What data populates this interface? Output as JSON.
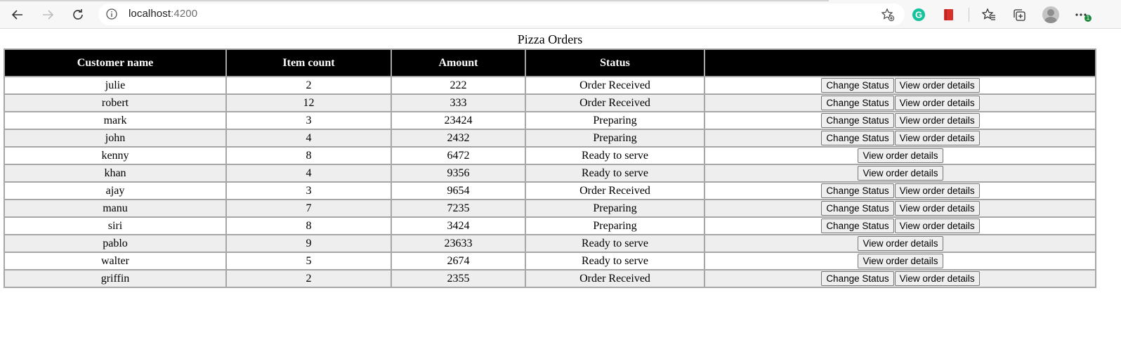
{
  "browser": {
    "url_host": "localhost",
    "url_port": ":4200",
    "icons": {
      "back": "back-arrow-icon",
      "forward": "forward-arrow-icon",
      "reload": "reload-icon",
      "info": "info-icon",
      "favorite": "add-favorite-icon",
      "grammarly": "grammarly-icon",
      "extension": "red-book-extension-icon",
      "favorites": "favorites-star-icon",
      "collections": "collections-icon",
      "profile": "profile-avatar-icon",
      "menu": "more-menu-icon"
    },
    "menu_badge": "1"
  },
  "page": {
    "title": "Pizza Orders"
  },
  "table": {
    "headers": [
      "Customer name",
      "Item count",
      "Amount",
      "Status",
      ""
    ],
    "change_status_label": "Change Status",
    "view_details_label": "View order details",
    "rows": [
      {
        "name": "julie",
        "count": "2",
        "amount": "222",
        "status": "Order Received",
        "can_change": true
      },
      {
        "name": "robert",
        "count": "12",
        "amount": "333",
        "status": "Order Received",
        "can_change": true
      },
      {
        "name": "mark",
        "count": "3",
        "amount": "23424",
        "status": "Preparing",
        "can_change": true
      },
      {
        "name": "john",
        "count": "4",
        "amount": "2432",
        "status": "Preparing",
        "can_change": true
      },
      {
        "name": "kenny",
        "count": "8",
        "amount": "6472",
        "status": "Ready to serve",
        "can_change": false
      },
      {
        "name": "khan",
        "count": "4",
        "amount": "9356",
        "status": "Ready to serve",
        "can_change": false
      },
      {
        "name": "ajay",
        "count": "3",
        "amount": "9654",
        "status": "Order Received",
        "can_change": true
      },
      {
        "name": "manu",
        "count": "7",
        "amount": "7235",
        "status": "Preparing",
        "can_change": true
      },
      {
        "name": "siri",
        "count": "8",
        "amount": "3424",
        "status": "Preparing",
        "can_change": true
      },
      {
        "name": "pablo",
        "count": "9",
        "amount": "23633",
        "status": "Ready to serve",
        "can_change": false
      },
      {
        "name": "walter",
        "count": "5",
        "amount": "2674",
        "status": "Ready to serve",
        "can_change": false
      },
      {
        "name": "griffin",
        "count": "2",
        "amount": "2355",
        "status": "Order Received",
        "can_change": true
      }
    ]
  },
  "colors": {
    "header_bg": "#000000",
    "header_text": "#ffffff",
    "row_alt_bg": "#eeeeee",
    "grid": "#a6a6a6"
  }
}
